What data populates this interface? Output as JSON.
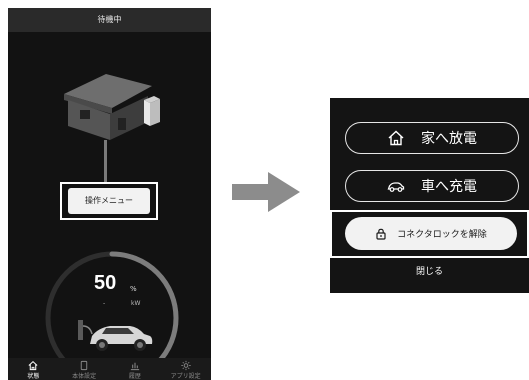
{
  "left_screen": {
    "status_title": "待機中",
    "menu_button_label": "操作メニュー",
    "gauge": {
      "value": "50",
      "percent_unit": "%",
      "power_dash": "-",
      "power_unit": "kW",
      "level": 0.5
    },
    "tabs": [
      {
        "label": "状態",
        "icon": "home-icon",
        "active": true
      },
      {
        "label": "本体設定",
        "icon": "device-icon",
        "active": false
      },
      {
        "label": "履歴",
        "icon": "chart-icon",
        "active": false
      },
      {
        "label": "アプリ設定",
        "icon": "gear-icon",
        "active": false
      }
    ]
  },
  "operation_menu": {
    "discharge_to_home": "家へ放電",
    "charge_car": "車へ充電",
    "unlock_connector": "コネクタロックを解除",
    "close": "閉じる"
  },
  "colors": {
    "background_dark": "#121212",
    "highlight_border": "#ffffff",
    "arrow": "#8c8c8c"
  }
}
